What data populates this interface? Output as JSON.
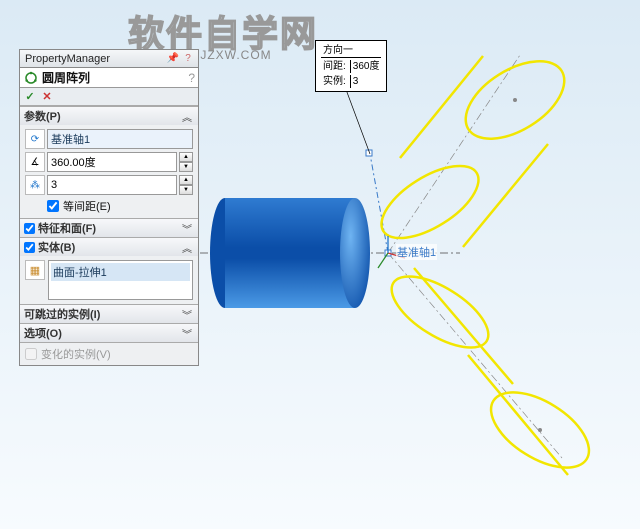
{
  "watermark": {
    "main": "软件自学网",
    "sub": "WWW.RJZXW.COM"
  },
  "callout": {
    "heading": "方向一",
    "rows": [
      {
        "label": "间距:",
        "value": "360度"
      },
      {
        "label": "实例:",
        "value": "3"
      }
    ]
  },
  "axis_label": "基准轴1",
  "pm": {
    "title": "PropertyManager",
    "feature_title": "圆周阵列",
    "ok_tip": "✓",
    "cancel_tip": "✕",
    "sections": {
      "params": {
        "title": "参数(P)",
        "axis_value": "基准轴1",
        "angle_value": "360.00度",
        "count_value": "3",
        "equal_spacing_label": "等间距(E)",
        "equal_spacing_checked": true
      },
      "features": {
        "title": "特征和面(F)"
      },
      "bodies": {
        "title": "实体(B)",
        "items": [
          "曲面-拉伸1"
        ]
      },
      "skippable": {
        "title": "可跳过的实例(I)"
      },
      "options": {
        "title": "选项(O)"
      },
      "varied": {
        "label": "变化的实例(V)",
        "checked": false
      }
    }
  },
  "icons": {
    "pin": "📌",
    "help": "?",
    "circ": "↻",
    "dir": "⟳",
    "angle": "∡",
    "count": "⁂",
    "body": "▦",
    "up": "▲",
    "down": "▼",
    "collapse": "︽",
    "expand": "︾"
  }
}
